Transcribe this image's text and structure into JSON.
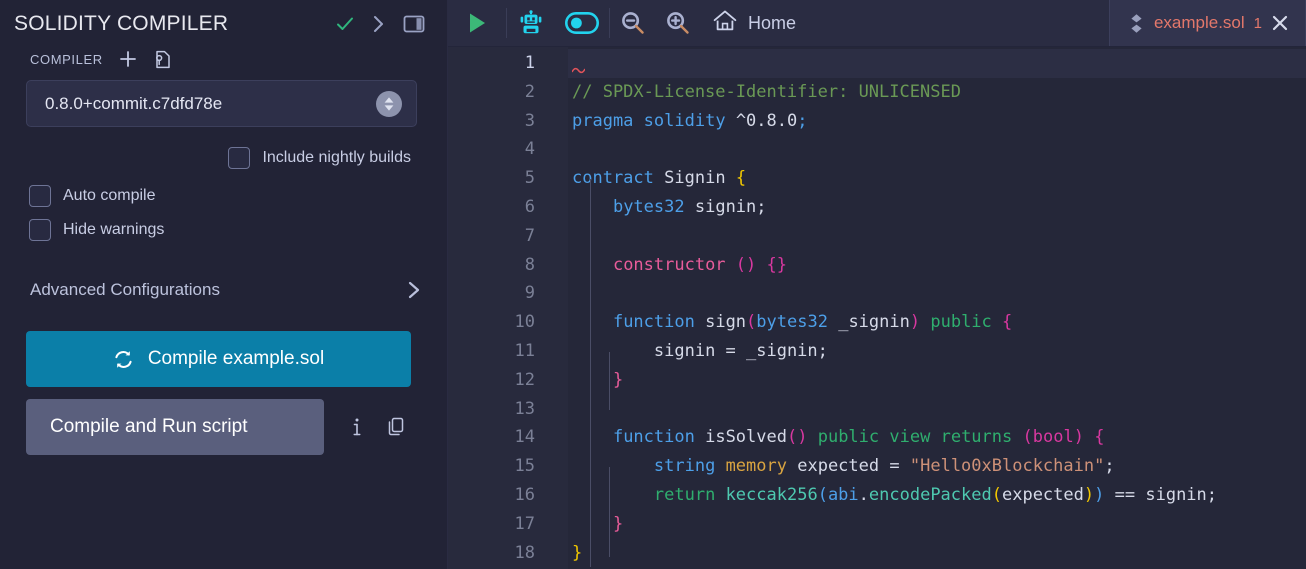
{
  "left_panel": {
    "title": "SOLIDITY COMPILER",
    "header_icons": [
      {
        "name": "check-icon",
        "color": "#2fb67d"
      },
      {
        "name": "chevron-right-icon",
        "color": "#9aa2c4"
      },
      {
        "name": "layout-panel-icon",
        "color": "#9aa2c4"
      }
    ],
    "compiler_section_label": "COMPILER",
    "compiler_add_icon": "plus-icon",
    "compiler_config_icon": "config-file-icon",
    "compiler_version": "0.8.0+commit.c7dfd78e",
    "stepper_icon": "up-down-arrows-icon",
    "checkboxes": [
      {
        "label": "Include nightly builds",
        "checked": false
      },
      {
        "label": "Auto compile",
        "checked": false
      },
      {
        "label": "Hide warnings",
        "checked": false
      }
    ],
    "advanced_label": "Advanced Configurations",
    "advanced_chevron_icon": "chevron-right-icon",
    "compile_button": {
      "label": "Compile example.sol",
      "icon": "refresh-icon",
      "color": "#0b7fa8"
    },
    "run_script_button": {
      "label": "Compile and Run script",
      "color": "#5a5f7d"
    },
    "info_icon": "info-icon",
    "copy_icon": "copy-icon"
  },
  "toolbar": {
    "play_icon": "play-icon",
    "play_color": "#3cb878",
    "robot_icon": "robot-icon",
    "robot_color": "#22d3ee",
    "toggle_icon": "toggle-switch-icon",
    "toggle_color": "#22d3ee",
    "zoom_out_icon": "zoom-out-icon",
    "zoom_in_icon": "zoom-in-icon",
    "home_icon": "home-icon",
    "home_label": "Home"
  },
  "tab": {
    "file_icon": "solidity-logo-icon",
    "name": "example.sol",
    "count": "1",
    "close_icon": "close-icon",
    "name_color": "#e4786b"
  },
  "editor": {
    "active_line": 1,
    "line_numbers": [
      "1",
      "2",
      "3",
      "4",
      "5",
      "6",
      "7",
      "8",
      "9",
      "10",
      "11",
      "12",
      "13",
      "14",
      "15",
      "16",
      "17",
      "18"
    ],
    "lines": [
      "",
      "// SPDX-License-Identifier: UNLICENSED",
      "pragma solidity ^0.8.0;",
      "",
      "contract Signin {",
      "    bytes32 signin;",
      "",
      "    constructor () {}",
      "",
      "    function sign(bytes32 _signin) public {",
      "        signin = _signin;",
      "    }",
      "",
      "    function isSolved() public view returns (bool) {",
      "        string memory expected = \"Hello0xBlockchain\";",
      "        return keccak256(abi.encodePacked(expected)) == signin;",
      "    }",
      "}"
    ]
  }
}
